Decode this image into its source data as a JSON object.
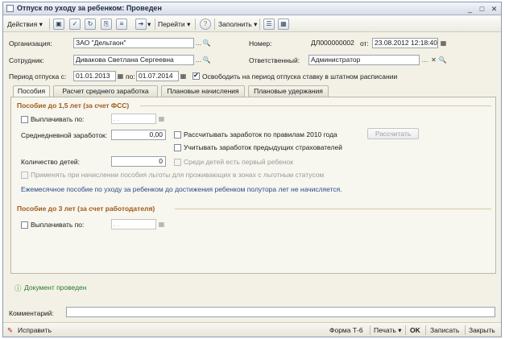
{
  "window": {
    "title": "Отпуск по уходу за ребенком: Проведен",
    "controls": {
      "minimize": "_",
      "maximize": "□",
      "close": "✕"
    }
  },
  "toolbar": {
    "actions": "Действия",
    "goto": "Перейти",
    "help": "?",
    "fill": "Заполнить",
    "icons": [
      "save-icon",
      "post-icon",
      "refresh-icon",
      "copy-icon",
      "structure-icon",
      "arrow-icon",
      "help-icon",
      "list-icon"
    ]
  },
  "header": {
    "org_label": "Организация:",
    "org_value": "ЗАО \"Дельтаон\"",
    "emp_label": "Сотрудник:",
    "emp_value": "Дивакова Светлана Сергеевна",
    "number_label": "Номер:",
    "number_value": "ДЛ000000002",
    "from_label": "от:",
    "date_value": "23.08.2012 12:18:40",
    "resp_label": "Ответственный:",
    "resp_value": "Администратор",
    "period_label": "Период отпуска с:",
    "period_from": "01.01.2013",
    "period_to_label": "по:",
    "period_to": "01.07.2014",
    "free_rate_label": "Освободить на период отпуска ставку в штатном расписании",
    "free_rate_checked": true
  },
  "tabs": [
    {
      "label": "Пособия",
      "active": true
    },
    {
      "label": "Расчет среднего заработка",
      "active": false
    },
    {
      "label": "Плановые начисления",
      "active": false
    },
    {
      "label": "Плановые удержания",
      "active": false
    }
  ],
  "section1": {
    "title": "Пособие до 1,5 лет (за счет ФСС)",
    "pay_until_label": "Выплачивать по:",
    "pay_until_value": " .  .",
    "avg_label": "Среднедневной заработок:",
    "avg_value": "0,00",
    "rules2010_label": "Рассчитывать заработок по правилам 2010 года",
    "prev_ins_label": "Учитывать заработок предыдущих страхователей",
    "calc_button": "Рассчитать",
    "children_label": "Количество детей:",
    "children_value": "0",
    "first_child_label": "Среди детей есть первый ребенок",
    "benefit_zone_label": "Применять при начислении пособия льготы для проживающих в зонах с льготным статусом",
    "info_text": "Ежемесячное пособие по уходу за ребенком до достижения ребенком полутора лет не начисляется."
  },
  "section2": {
    "title": "Пособие до 3 лет (за счет работодателя)",
    "pay_until_label": "Выплачивать по:",
    "pay_until_value": " .  ."
  },
  "status": {
    "text": "Документ проведен"
  },
  "comment": {
    "label": "Комментарий:",
    "value": ""
  },
  "footer": {
    "fix": "Исправить",
    "form": "Форма Т-6",
    "print": "Печать",
    "ok": "OK",
    "save": "Записать",
    "close": "Закрыть"
  },
  "colors": {
    "section_title": "#a05a1a",
    "info_text": "#2a4c8a",
    "status_green": "#2a7a2a"
  }
}
